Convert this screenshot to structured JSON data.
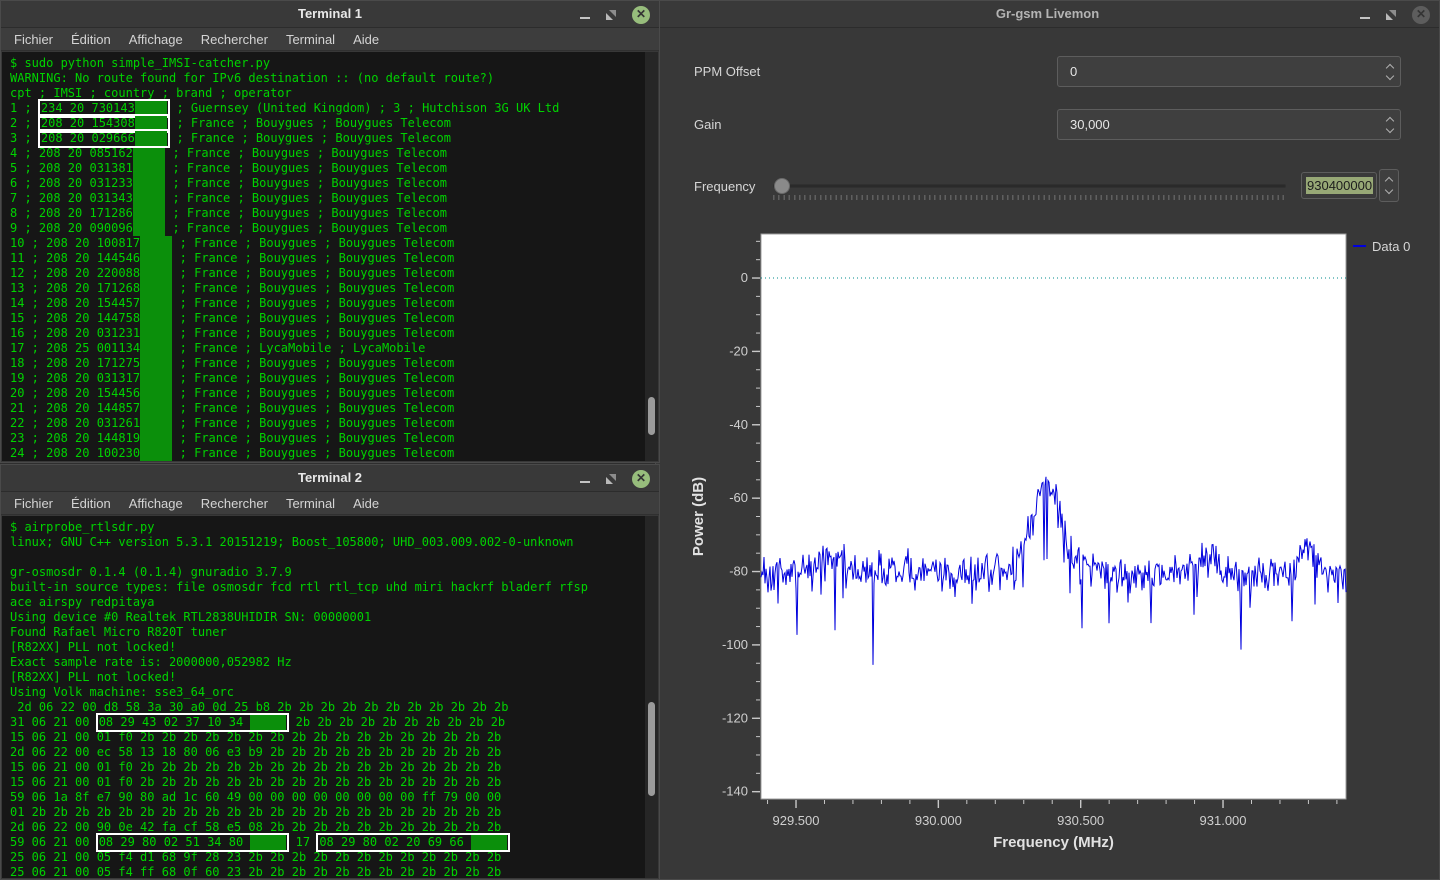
{
  "terminal1": {
    "title": "Terminal 1",
    "menu": [
      "Fichier",
      "Édition",
      "Affichage",
      "Rechercher",
      "Terminal",
      "Aide"
    ],
    "pre_lines": [
      "$ sudo python simple_IMSI-catcher.py",
      "WARNING: No route found for IPv6 destination :: (no default route?)",
      "cpt ; IMSI ; country ; brand ; operator"
    ],
    "mask_chars": 4.5,
    "rows": [
      {
        "n": "1",
        "imsi": "234 20 730143",
        "boxed": true,
        "rest": "Guernsey (United Kingdom) ; 3 ; Hutchison 3G UK Ltd"
      },
      {
        "n": "2",
        "imsi": "208 20 154308",
        "boxed": true,
        "rest": "France ; Bouygues ; Bouygues Telecom"
      },
      {
        "n": "3",
        "imsi": "208 20 029666",
        "boxed": true,
        "rest": "France ; Bouygues ; Bouygues Telecom"
      },
      {
        "n": "4",
        "imsi": "208 20 085162",
        "boxed": false,
        "rest": "France ; Bouygues ; Bouygues Telecom"
      },
      {
        "n": "5",
        "imsi": "208 20 031381",
        "boxed": false,
        "rest": "France ; Bouygues ; Bouygues Telecom"
      },
      {
        "n": "6",
        "imsi": "208 20 031233",
        "boxed": false,
        "rest": "France ; Bouygues ; Bouygues Telecom"
      },
      {
        "n": "7",
        "imsi": "208 20 031343",
        "boxed": false,
        "rest": "France ; Bouygues ; Bouygues Telecom"
      },
      {
        "n": "8",
        "imsi": "208 20 171286",
        "boxed": false,
        "rest": "France ; Bouygues ; Bouygues Telecom"
      },
      {
        "n": "9",
        "imsi": "208 20 090096",
        "boxed": false,
        "rest": "France ; Bouygues ; Bouygues Telecom"
      },
      {
        "n": "10",
        "imsi": "208 20 100817",
        "boxed": false,
        "rest": "France ; Bouygues ; Bouygues Telecom"
      },
      {
        "n": "11",
        "imsi": "208 20 144546",
        "boxed": false,
        "rest": "France ; Bouygues ; Bouygues Telecom"
      },
      {
        "n": "12",
        "imsi": "208 20 220088",
        "boxed": false,
        "rest": "France ; Bouygues ; Bouygues Telecom"
      },
      {
        "n": "13",
        "imsi": "208 20 171268",
        "boxed": false,
        "rest": "France ; Bouygues ; Bouygues Telecom"
      },
      {
        "n": "14",
        "imsi": "208 20 154457",
        "boxed": false,
        "rest": "France ; Bouygues ; Bouygues Telecom"
      },
      {
        "n": "15",
        "imsi": "208 20 144758",
        "boxed": false,
        "rest": "France ; Bouygues ; Bouygues Telecom"
      },
      {
        "n": "16",
        "imsi": "208 20 031231",
        "boxed": false,
        "rest": "France ; Bouygues ; Bouygues Telecom"
      },
      {
        "n": "17",
        "imsi": "208 25 001134",
        "boxed": false,
        "rest": "France ; LycaMobile ; LycaMobile"
      },
      {
        "n": "18",
        "imsi": "208 20 171275",
        "boxed": false,
        "rest": "France ; Bouygues ; Bouygues Telecom"
      },
      {
        "n": "19",
        "imsi": "208 20 031317",
        "boxed": false,
        "rest": "France ; Bouygues ; Bouygues Telecom"
      },
      {
        "n": "20",
        "imsi": "208 20 154456",
        "boxed": false,
        "rest": "France ; Bouygues ; Bouygues Telecom"
      },
      {
        "n": "21",
        "imsi": "208 20 144857",
        "boxed": false,
        "rest": "France ; Bouygues ; Bouygues Telecom"
      },
      {
        "n": "22",
        "imsi": "208 20 031261",
        "boxed": false,
        "rest": "France ; Bouygues ; Bouygues Telecom"
      },
      {
        "n": "23",
        "imsi": "208 20 144819",
        "boxed": false,
        "rest": "France ; Bouygues ; Bouygues Telecom"
      },
      {
        "n": "24",
        "imsi": "208 20 100230",
        "boxed": false,
        "rest": "France ; Bouygues ; Bouygues Telecom"
      }
    ]
  },
  "terminal2": {
    "title": "Terminal 2",
    "menu": [
      "Fichier",
      "Édition",
      "Affichage",
      "Rechercher",
      "Terminal",
      "Aide"
    ],
    "lines": [
      {
        "parts": [
          {
            "t": "$ airprobe_rtlsdr.py"
          }
        ]
      },
      {
        "parts": [
          {
            "t": "linux; GNU C++ version 5.3.1 20151219; Boost_105800; UHD_003.009.002-0-unknown"
          }
        ]
      },
      {
        "parts": [
          {
            "t": ""
          }
        ]
      },
      {
        "parts": [
          {
            "t": "gr-osmosdr 0.1.4 (0.1.4) gnuradio 3.7.9"
          }
        ]
      },
      {
        "parts": [
          {
            "t": "built-in source types: file osmosdr fcd rtl rtl_tcp uhd miri hackrf bladerf rfsp"
          }
        ]
      },
      {
        "parts": [
          {
            "t": "ace airspy redpitaya"
          }
        ]
      },
      {
        "parts": [
          {
            "t": "Using device #0 Realtek RTL2838UHIDIR SN: 00000001"
          }
        ]
      },
      {
        "parts": [
          {
            "t": "Found Rafael Micro R820T tuner"
          }
        ]
      },
      {
        "parts": [
          {
            "t": "[R82XX] PLL not locked!"
          }
        ]
      },
      {
        "parts": [
          {
            "t": "Exact sample rate is: 2000000,052982 Hz"
          }
        ]
      },
      {
        "parts": [
          {
            "t": "[R82XX] PLL not locked!"
          }
        ]
      },
      {
        "parts": [
          {
            "t": "Using Volk machine: sse3_64_orc"
          }
        ]
      },
      {
        "parts": [
          {
            "t": " 2d 06 22 00 d8 58 3a 30 a0 0d 25 b8 2b 2b 2b 2b 2b 2b 2b 2b 2b 2b 2b"
          }
        ]
      },
      {
        "parts": [
          {
            "t": "31 06 21 00 "
          },
          {
            "boxed": [
              {
                "t": "08 29 43 02 37 10 34 "
              },
              {
                "blk": 5
              }
            ]
          },
          {
            "t": " 2b 2b 2b 2b 2b 2b 2b 2b 2b 2b"
          }
        ]
      },
      {
        "parts": [
          {
            "t": "15 06 21 00 01 f0 2b 2b 2b 2b 2b 2b 2b 2b 2b 2b 2b 2b 2b 2b 2b 2b 2b"
          }
        ]
      },
      {
        "parts": [
          {
            "t": "2d 06 22 00 ec 58 13 18 80 06 e3 b9 2b 2b 2b 2b 2b 2b 2b 2b 2b 2b 2b"
          }
        ]
      },
      {
        "parts": [
          {
            "t": "15 06 21 00 01 f0 2b 2b 2b 2b 2b 2b 2b 2b 2b 2b 2b 2b 2b 2b 2b 2b 2b"
          }
        ]
      },
      {
        "parts": [
          {
            "t": "15 06 21 00 01 f0 2b 2b 2b 2b 2b 2b 2b 2b 2b 2b 2b 2b 2b 2b 2b 2b 2b"
          }
        ]
      },
      {
        "parts": [
          {
            "t": "59 06 1a 8f e7 90 80 ad 1c 60 49 00 00 00 00 00 00 00 00 ff 79 00 00"
          }
        ]
      },
      {
        "parts": [
          {
            "t": "01 2b 2b 2b 2b 2b 2b 2b 2b 2b 2b 2b 2b 2b 2b 2b 2b 2b 2b 2b 2b 2b 2b"
          }
        ]
      },
      {
        "parts": [
          {
            "t": "2d 06 22 00 90 0e 42 fa cf 58 e5 08 2b 2b 2b 2b 2b 2b 2b 2b 2b 2b 2b"
          }
        ]
      },
      {
        "parts": [
          {
            "t": "59 06 21 00 "
          },
          {
            "boxed": [
              {
                "t": "08 29 80 02 51 34 80 "
              },
              {
                "blk": 5
              }
            ]
          },
          {
            "t": " 17 "
          },
          {
            "boxed": [
              {
                "t": "08 29 80 02 20 69 66 "
              },
              {
                "blk": 5
              }
            ]
          }
        ]
      },
      {
        "parts": [
          {
            "t": "25 06 21 00 05 f4 d1 68 9f 28 23 2b 2b 2b 2b 2b 2b 2b 2b 2b 2b 2b 2b"
          }
        ]
      },
      {
        "parts": [
          {
            "t": "25 06 21 00 05 f4 ff 68 0f 60 23 2b 2b 2b 2b 2b 2b 2b 2b 2b 2b 2b 2b"
          }
        ]
      }
    ]
  },
  "livemon": {
    "title": "Gr-gsm Livemon",
    "ppm_label": "PPM Offset",
    "ppm_value": "0",
    "gain_label": "Gain",
    "gain_value": "30,000",
    "freq_label": "Frequency",
    "freq_value": "930400000"
  },
  "chart_data": {
    "type": "line",
    "title": "",
    "xlabel": "Frequency (MHz)",
    "ylabel": "Power (dB)",
    "legend": [
      "Data 0"
    ],
    "legend_position": "top-right-outside",
    "grid": false,
    "xlim": [
      929.377,
      931.432
    ],
    "ylim": [
      -142,
      12
    ],
    "x_ticks": [
      {
        "v": 929.5,
        "label": "929.500"
      },
      {
        "v": 930.0,
        "label": "930.000"
      },
      {
        "v": 930.5,
        "label": "930.500"
      },
      {
        "v": 931.0,
        "label": "931.000"
      }
    ],
    "x_minor_step": 0.1,
    "y_ticks": [
      {
        "v": 0,
        "label": "0"
      },
      {
        "v": -20,
        "label": "-20"
      },
      {
        "v": -40,
        "label": "-40"
      },
      {
        "v": -60,
        "label": "-60"
      },
      {
        "v": -80,
        "label": "-80"
      },
      {
        "v": -100,
        "label": "-100"
      },
      {
        "v": -120,
        "label": "-120"
      },
      {
        "v": -140,
        "label": "-140"
      }
    ],
    "y_minor_step": 5,
    "zero_line": {
      "value": 0,
      "color": "#008b8b",
      "style": "dotted"
    },
    "series": [
      {
        "name": "Data 0",
        "color": "#0000dd",
        "baseline_db": -80,
        "noise_db": 7.5,
        "spike_prob": 0.055,
        "spike_depth_db": 22,
        "deep_spike_prob": 0.012,
        "deep_spike_db": 36,
        "peaks": [
          {
            "freq_mhz": 930.38,
            "gain_db": 26,
            "sigma_mhz": 0.05
          },
          {
            "freq_mhz": 929.62,
            "gain_db": 5,
            "sigma_mhz": 0.035
          },
          {
            "freq_mhz": 930.95,
            "gain_db": 4,
            "sigma_mhz": 0.03
          },
          {
            "freq_mhz": 931.3,
            "gain_db": 7,
            "sigma_mhz": 0.025
          }
        ],
        "seed": 1337
      }
    ]
  }
}
